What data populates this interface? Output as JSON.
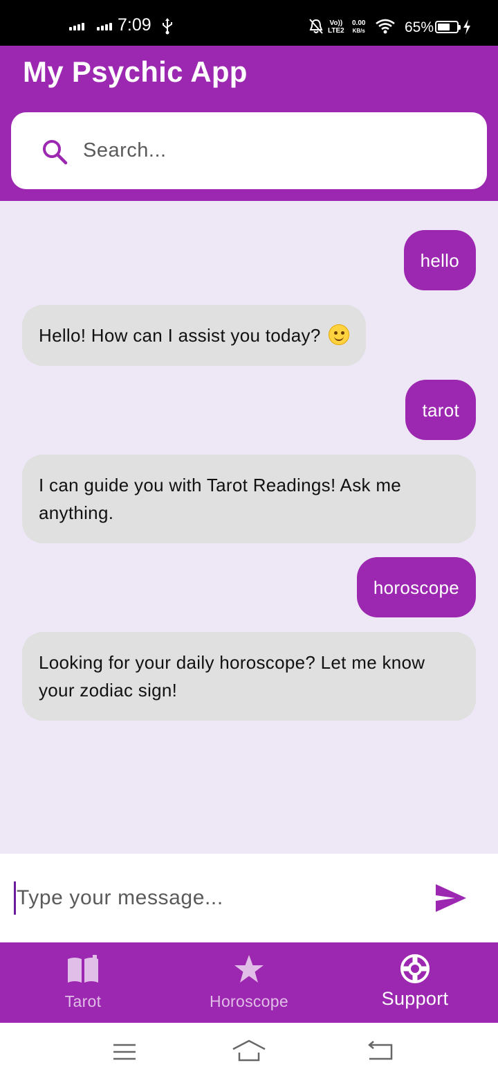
{
  "status_bar": {
    "time": "7:09",
    "volte_label_1": "Vo))",
    "volte_label_2": "LTE2",
    "speed_value": "0.00",
    "speed_unit": "KB/s",
    "battery_percent": "65%",
    "battery_level": 0.65,
    "icons": [
      "signal-icon",
      "signal-icon",
      "usb-icon",
      "mute-bell-icon",
      "wifi-icon",
      "battery-icon",
      "charging-icon"
    ]
  },
  "app": {
    "title": "My Psychic App",
    "brand_color": "#9c27b0"
  },
  "search": {
    "placeholder": "Search...",
    "icon": "search-icon"
  },
  "chat": {
    "messages": [
      {
        "sender": "user",
        "text": "hello"
      },
      {
        "sender": "bot",
        "text": "Hello! How can I assist you today?",
        "emoji": "smiling-face"
      },
      {
        "sender": "user",
        "text": "tarot"
      },
      {
        "sender": "bot",
        "text": "I can guide you with Tarot Readings! Ask me anything."
      },
      {
        "sender": "user",
        "text": "horoscope"
      },
      {
        "sender": "bot",
        "text": "Looking for your daily horoscope? Let me know your zodiac sign!"
      }
    ],
    "user_bubble_color": "#9c27b0",
    "bot_bubble_color": "#e0e0e0",
    "background_color": "#ede7f6"
  },
  "composer": {
    "placeholder": "Type your message...",
    "send_icon": "send-icon"
  },
  "bottom_nav": {
    "items": [
      {
        "label": "Tarot",
        "icon": "book-icon",
        "active": false
      },
      {
        "label": "Horoscope",
        "icon": "star-icon",
        "active": false
      },
      {
        "label": "Support",
        "icon": "lifebuoy-icon",
        "active": true
      }
    ]
  },
  "system_nav": {
    "icons": [
      "menu-icon",
      "home-icon",
      "back-icon"
    ]
  }
}
